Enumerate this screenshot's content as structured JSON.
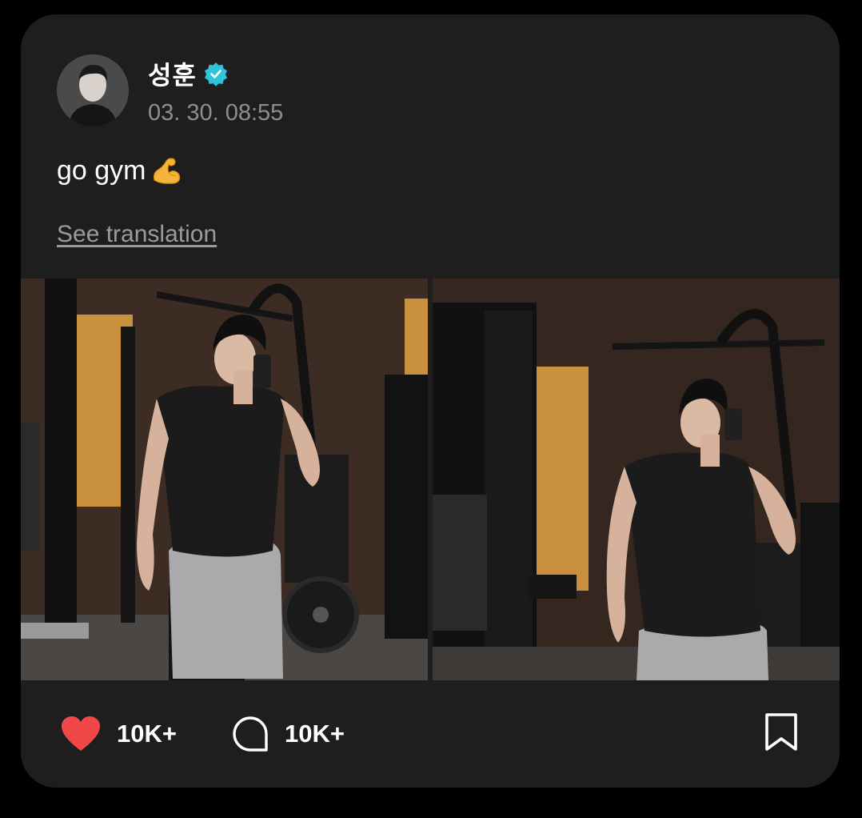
{
  "post": {
    "author": "성훈",
    "verified": true,
    "timestamp": "03. 30. 08:55",
    "text": "go gym",
    "emoji": "flexed-biceps",
    "translate_label": "See translation",
    "images": [
      {
        "description": "gym-mirror-selfie-1"
      },
      {
        "description": "gym-mirror-selfie-2"
      }
    ]
  },
  "actions": {
    "likes": "10K+",
    "comments": "10K+"
  },
  "colors": {
    "background": "#000000",
    "card": "#1e1e1e",
    "like": "#f04848",
    "verified": "#2ec4d9",
    "muted_text": "#8e8e8e"
  },
  "icons": [
    "heart-icon",
    "comment-icon",
    "bookmark-icon",
    "verified-icon"
  ]
}
